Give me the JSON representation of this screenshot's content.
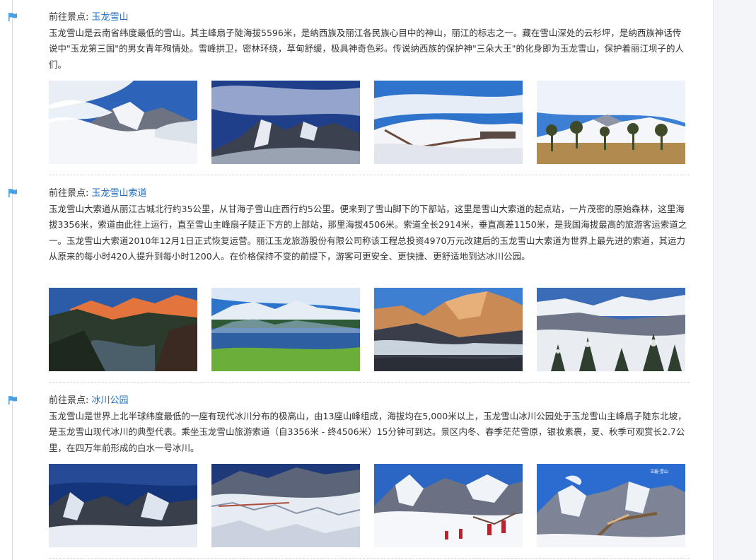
{
  "sections": [
    {
      "heading_prefix": "前往景点: ",
      "heading_link": "玉龙雪山",
      "description": "玉龙雪山是云南省纬度最低的雪山。其主峰扇子陡海拔5596米，是纳西族及丽江各民族心目中的神山，丽江的标志之一。藏在雪山深处的云杉坪，是纳西族神话传说中\"玉龙第三国\"的男女青年殉情处。雪峰拱卫，密林环绕，草甸舒缓，极具神奇色彩。传说纳西族的保护神\"三朵大王\"的化身即为玉龙雪山，保护着丽江坝子的人们。",
      "photos": [
        "雪山云雾",
        "蓝天雪峰",
        "观景栈道",
        "云杉与雪山"
      ]
    },
    {
      "heading_prefix": "前往景点: ",
      "heading_link": "玉龙雪山索道",
      "description": "玉龙雪山大索道从丽江古城北行约35公里，从甘海子雪山庄西行约5公里。便来到了雪山脚下的下部站，这里是雪山大索道的起点站，一片茂密的原始森林，这里海拔3356米，索道由此往上运行，直至雪山主峰扇子陡正下方的上部站，那里海拔4506米。索道全长2914米，垂直高差1150米，是我国海拔最高的旅游客运索道之一。玉龙雪山大索道2010年12月1日正式恢复运营。丽江玉龙旅游股份有限公司称该工程总投资4970万元改建后的玉龙雪山大索道为世界上最先进的索道，其运力从原来的每小时420人提升到每小时1200人。在价格保持不变的前提下，游客可更安全、更快捷、更舒适地到达冰川公园。",
      "photos": [
        "日照金山",
        "蓝月谷倒影",
        "晨光雪峰",
        "雪松林"
      ]
    },
    {
      "heading_prefix": "前往景点: ",
      "heading_link": "冰川公园",
      "description": "玉龙雪山是世界上北半球纬度最低的一座有现代冰川分布的极高山，由13座山峰组成，海拔均在5,000米以上，玉龙雪山冰川公园处于玉龙雪山主峰扇子陡东北坡，是玉龙雪山现代冰川的典型代表。乘坐玉龙雪山旅游索道（自3356米 - 终4506米）15分钟可到达。景区内冬、春季茫茫雪原，银妆素裹，夏、秋季可观赏长2.7公里，在四万年前形成的白水一号冰川。",
      "photos": [
        "夜色雪峰",
        "冰川栈道",
        "游客登山",
        "雪山观景台"
      ],
      "watermark": "玉龍·雪山"
    }
  ],
  "colors": {
    "link": "#1f6fbf",
    "flag": "#4a9fe0",
    "rail": "#f3f5f8"
  }
}
